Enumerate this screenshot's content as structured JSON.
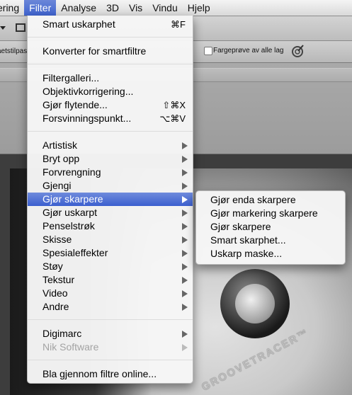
{
  "menubar": {
    "items": [
      {
        "label": "ering",
        "active": false
      },
      {
        "label": "Filter",
        "active": true
      },
      {
        "label": "Analyse",
        "active": false
      },
      {
        "label": "3D",
        "active": false
      },
      {
        "label": "Vis",
        "active": false
      },
      {
        "label": "Vindu",
        "active": false
      },
      {
        "label": "Hjelp",
        "active": false
      }
    ]
  },
  "options_bar": {
    "left_text": "aetstilpas",
    "checkbox_label": "Fargeprøve av alle lag",
    "checkbox_checked": false
  },
  "canvas": {
    "brand_text": "GROOVETRACER™"
  },
  "filter_menu": {
    "items": [
      {
        "label": "Smart uskarphet",
        "shortcut": "⌘F"
      },
      {
        "label": "Konverter for smartfiltre"
      },
      {
        "label": "Filtergalleri..."
      },
      {
        "label": "Objektivkorrigering..."
      },
      {
        "label": "Gjør flytende...",
        "shortcut": "⇧⌘X"
      },
      {
        "label": "Forsvinningspunkt...",
        "shortcut": "⌥⌘V"
      },
      {
        "label": "Artistisk",
        "submenu": true
      },
      {
        "label": "Bryt opp",
        "submenu": true
      },
      {
        "label": "Forvrengning",
        "submenu": true
      },
      {
        "label": "Gjengi",
        "submenu": true
      },
      {
        "label": "Gjør skarpere",
        "submenu": true,
        "highlighted": true
      },
      {
        "label": "Gjør uskarpt",
        "submenu": true
      },
      {
        "label": "Penselstrøk",
        "submenu": true
      },
      {
        "label": "Skisse",
        "submenu": true
      },
      {
        "label": "Spesialeffekter",
        "submenu": true
      },
      {
        "label": "Støy",
        "submenu": true
      },
      {
        "label": "Tekstur",
        "submenu": true
      },
      {
        "label": "Video",
        "submenu": true
      },
      {
        "label": "Andre",
        "submenu": true
      },
      {
        "label": "Digimarc",
        "submenu": true
      },
      {
        "label": "Nik Software",
        "submenu": true,
        "disabled": true
      },
      {
        "label": "Bla gjennom filtre online..."
      }
    ]
  },
  "sharpen_submenu": {
    "items": [
      {
        "label": "Gjør enda skarpere"
      },
      {
        "label": "Gjør markering skarpere"
      },
      {
        "label": "Gjør skarpere"
      },
      {
        "label": "Smart skarphet..."
      },
      {
        "label": "Uskarp maske..."
      }
    ]
  },
  "colors": {
    "highlight": "#3f63cf",
    "menu_bg": "#f6f6f6",
    "disabled_text": "#a3a3a3"
  }
}
